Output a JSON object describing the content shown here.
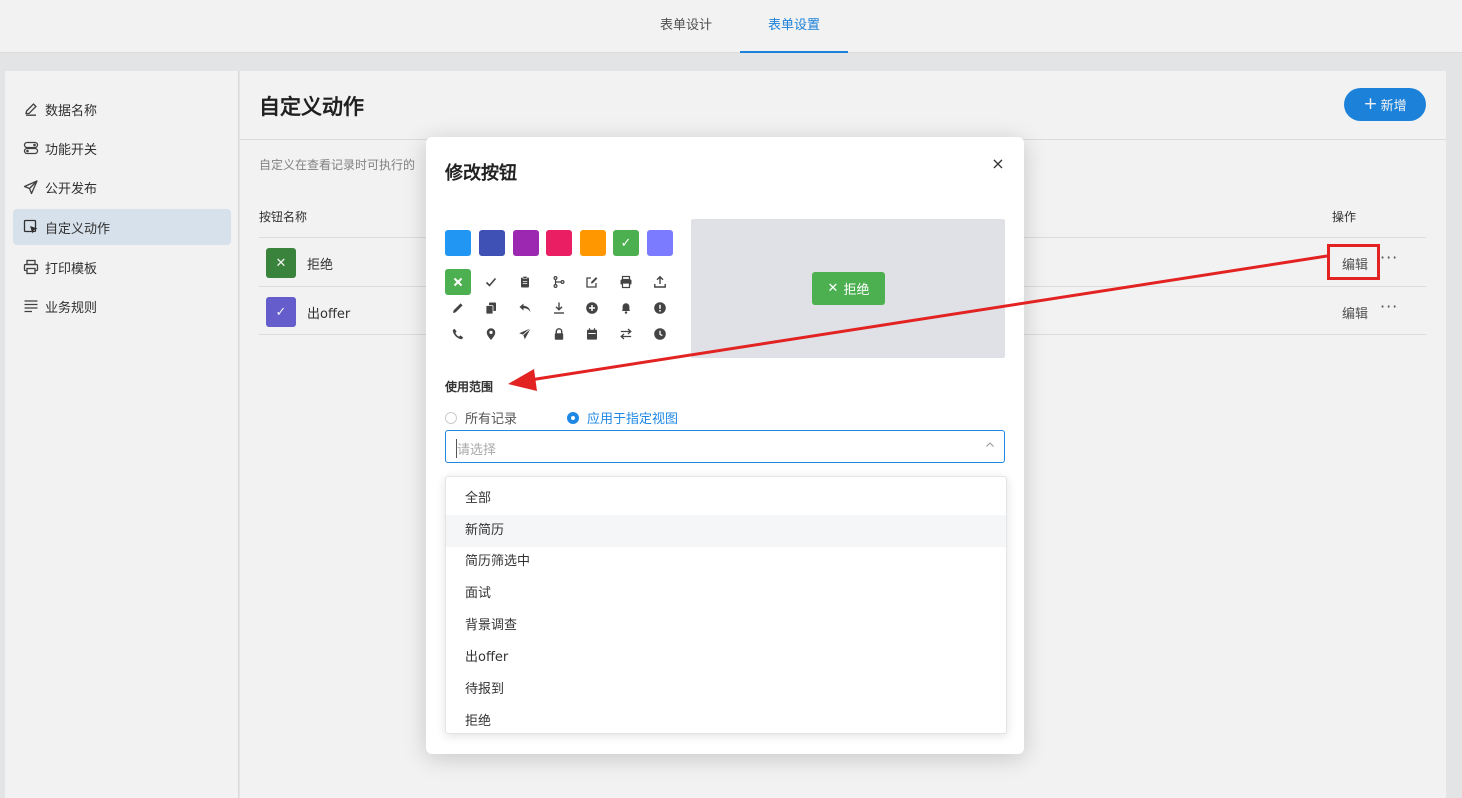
{
  "colors": {
    "accent": "#1e88e5",
    "annotation_red": "#e32222",
    "green": "#4caf50"
  },
  "top_tabs": [
    {
      "label": "表单设计",
      "active": false
    },
    {
      "label": "表单设置",
      "active": true
    }
  ],
  "sidebar": {
    "items": [
      {
        "label": "数据名称",
        "icon": "edit-icon",
        "active": false
      },
      {
        "label": "功能开关",
        "icon": "toggle-icon",
        "active": false
      },
      {
        "label": "公开发布",
        "icon": "send-icon",
        "active": false
      },
      {
        "label": "自定义动作",
        "icon": "cursor-icon",
        "active": true
      },
      {
        "label": "打印模板",
        "icon": "printer-icon",
        "active": false
      },
      {
        "label": "业务规则",
        "icon": "list-icon",
        "active": false
      }
    ]
  },
  "main": {
    "title": "自定义动作",
    "add_button": "新增",
    "description": "自定义在查看记录时可执行的",
    "table": {
      "headers": {
        "name": "按钮名称",
        "ops": "操作"
      },
      "rows": [
        {
          "name": "拒绝",
          "badge_icon": "close-icon",
          "badge_color": "#3d8b40",
          "edit": "编辑",
          "more": "···"
        },
        {
          "name": "出offer",
          "badge_icon": "check-icon",
          "badge_color": "#6b63d6",
          "edit": "编辑",
          "more": "···"
        }
      ]
    }
  },
  "modal": {
    "title": "修改按钮",
    "close": "×",
    "color_swatches": [
      "#2196f3",
      "#3f51b5",
      "#9c27b0",
      "#e91e63",
      "#ff9800",
      "#4caf50",
      "#7b7bff"
    ],
    "selected_color": "#4caf50",
    "icon_grid": [
      [
        "close-icon",
        "check-icon",
        "clipboard-icon",
        "branch-icon",
        "edit-square-icon",
        "printer-icon",
        "upload-icon"
      ],
      [
        "pencil-icon",
        "copy-icon",
        "reply-icon",
        "download-icon",
        "plus-circle-icon",
        "bell-icon",
        "alert-circle-icon"
      ],
      [
        "phone-icon",
        "location-pin-icon",
        "paper-plane-icon",
        "lock-icon",
        "calendar-icon",
        "swap-icon",
        "clock-icon"
      ]
    ],
    "selected_icon": "close-icon",
    "preview_button": {
      "label": "拒绝",
      "icon": "close-icon"
    },
    "scope_label": "使用范围",
    "scope_options": [
      {
        "label": "所有记录",
        "checked": false
      },
      {
        "label": "应用于指定视图",
        "checked": true
      }
    ],
    "select_placeholder": "请选择"
  },
  "dropdown": {
    "options": [
      "全部",
      "新简历",
      "简历筛选中",
      "面试",
      "背景调查",
      "出offer",
      "待报到",
      "拒绝"
    ],
    "hovered": "新简历"
  }
}
